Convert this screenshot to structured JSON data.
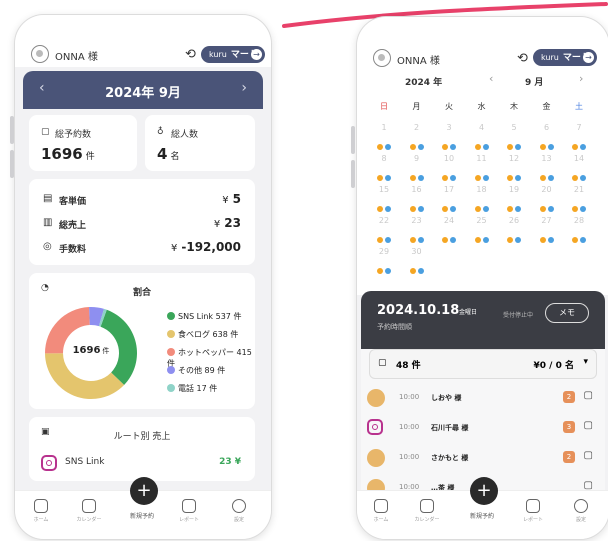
{
  "colors": {
    "accent_navy": "#4a5478",
    "dark_panel": "#3b3d44",
    "sns_link": "#3aa65a",
    "tabelog": "#e4c56d",
    "hotpepper": "#f28b7c",
    "other": "#8e8ff0",
    "phone": "#8fd3c8",
    "dot_orange": "#f5a623",
    "dot_blue": "#4a9fe0",
    "positive_green": "#3aa65a",
    "red_stroke": "#e8416a"
  },
  "left": {
    "user_name": "ONNA 様",
    "history_icon": "history-icon",
    "mart_button": {
      "prefix": "kuru",
      "label": "マート",
      "arrow": "→"
    },
    "month_nav": {
      "prev": "‹",
      "title": "2024年 9月",
      "next": "›"
    },
    "total_reservations": {
      "label": "総予約数",
      "value": "1696",
      "unit": "件"
    },
    "total_people": {
      "label": "総人数",
      "value": "4",
      "unit": "名"
    },
    "metrics": [
      {
        "icon": "wallet-icon",
        "label": "客単価",
        "currency": "¥",
        "value": "5"
      },
      {
        "icon": "register-icon",
        "label": "総売上",
        "currency": "¥",
        "value": "23"
      },
      {
        "icon": "coins-icon",
        "label": "手数料",
        "currency": "¥",
        "value": "-192,000"
      }
    ],
    "ratio": {
      "title": "割合",
      "center_value": "1696",
      "center_unit": "件",
      "legend": [
        {
          "name": "SNS Link",
          "value": "537 件"
        },
        {
          "name": "食べログ",
          "value": "638 件"
        },
        {
          "name": "ホットペッパー",
          "value": "415 件"
        },
        {
          "name": "その他",
          "value": "89 件"
        },
        {
          "name": "電話",
          "value": "17 件"
        }
      ]
    },
    "route_sales": {
      "title": "ルート別 売上",
      "row_name": "SNS Link",
      "row_value": "23 ¥"
    },
    "nav": [
      "ホーム",
      "カレンダー",
      "新規予約",
      "レポート",
      "設定"
    ]
  },
  "right": {
    "user_name": "ONNA 様",
    "mart_button": {
      "prefix": "kuru",
      "label": "マート",
      "arrow": "→"
    },
    "year": "2024 年",
    "month": "9 月",
    "prev": "‹",
    "next": "›",
    "weekdays": [
      "日",
      "月",
      "火",
      "水",
      "木",
      "金",
      "土"
    ],
    "days": [
      "1",
      "2",
      "3",
      "4",
      "5",
      "6",
      "7",
      "8",
      "9",
      "10",
      "11",
      "12",
      "13",
      "14",
      "15",
      "16",
      "17",
      "18",
      "19",
      "20",
      "21",
      "22",
      "23",
      "24",
      "25",
      "26",
      "27",
      "28",
      "29",
      "30"
    ],
    "selected": {
      "date": "2024.10.18",
      "weekday": "金曜日",
      "sub": "予約時間順",
      "status": "受付停止中",
      "memo": "メモ"
    },
    "summary": {
      "count": "48 件",
      "amount": "¥0 / 0 名",
      "caret": "▾"
    },
    "reservations": [
      {
        "time": "10:00",
        "name": "しおや 様",
        "count": "2"
      },
      {
        "time": "10:00",
        "name": "石川千尋 様",
        "count": "3"
      },
      {
        "time": "10:00",
        "name": "さかもと 様",
        "count": "2"
      },
      {
        "time": "10:00",
        "name": "…茶 様",
        "count": ""
      }
    ],
    "nav": [
      "ホーム",
      "カレンダー",
      "新規予約",
      "レポート",
      "設定"
    ]
  }
}
